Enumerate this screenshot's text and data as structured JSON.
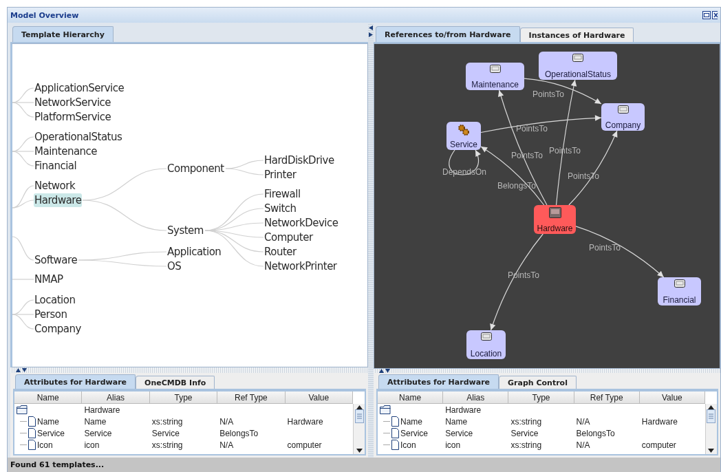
{
  "window": {
    "title": "Model Overview"
  },
  "hierarchy_pane": {
    "tabs": [
      {
        "label": "Template Hierarchy",
        "selected": true
      }
    ],
    "tree": {
      "groups": [
        {
          "children": [
            {
              "label": "ApplicationService",
              "selected": false
            },
            {
              "label": "NetworkService",
              "selected": false
            },
            {
              "label": "PlatformService",
              "selected": false
            }
          ]
        },
        {
          "children": [
            {
              "label": "OperationalStatus",
              "selected": false
            },
            {
              "label": "Maintenance",
              "selected": false
            },
            {
              "label": "Financial",
              "selected": false
            }
          ]
        },
        {
          "children": [
            {
              "label": "Network",
              "selected": false
            },
            {
              "label": "Hardware",
              "selected": true,
              "children": [
                {
                  "label": "Component",
                  "selected": false,
                  "children": [
                    {
                      "label": "HardDiskDrive",
                      "selected": false
                    },
                    {
                      "label": "Printer",
                      "selected": false
                    }
                  ]
                },
                {
                  "label": "System",
                  "selected": false,
                  "children": [
                    {
                      "label": "Firewall",
                      "selected": false
                    },
                    {
                      "label": "Switch",
                      "selected": false
                    },
                    {
                      "label": "NetworkDevice",
                      "selected": false
                    },
                    {
                      "label": "Computer",
                      "selected": false
                    },
                    {
                      "label": "Router",
                      "selected": false
                    },
                    {
                      "label": "NetworkPrinter",
                      "selected": false
                    }
                  ]
                }
              ]
            }
          ]
        },
        {
          "children": [
            {
              "label": "Software",
              "selected": false,
              "children": [
                {
                  "label": "Application",
                  "selected": false
                },
                {
                  "label": "OS",
                  "selected": false
                }
              ]
            }
          ]
        },
        {
          "children": [
            {
              "label": "NMAP",
              "selected": false
            }
          ]
        },
        {
          "children": [
            {
              "label": "Location",
              "selected": false
            },
            {
              "label": "Person",
              "selected": false
            },
            {
              "label": "Company",
              "selected": false
            }
          ]
        }
      ]
    }
  },
  "references_pane": {
    "tabs": [
      {
        "label": "References to/from Hardware",
        "selected": true
      },
      {
        "label": "Instances of Hardware",
        "selected": false
      }
    ],
    "graph": {
      "nodes": [
        {
          "label": "Maintenance",
          "kind": "ci",
          "selected": false
        },
        {
          "label": "OperationalStatus",
          "kind": "ci",
          "selected": false
        },
        {
          "label": "Company",
          "kind": "ci",
          "selected": false
        },
        {
          "label": "Service",
          "kind": "service",
          "selected": false
        },
        {
          "label": "Hardware",
          "kind": "hardware",
          "selected": true
        },
        {
          "label": "Financial",
          "kind": "ci",
          "selected": false
        },
        {
          "label": "Location",
          "kind": "ci",
          "selected": false
        }
      ],
      "edges": [
        {
          "label": "PointsTo"
        },
        {
          "label": "PointsTo"
        },
        {
          "label": "PointsTo"
        },
        {
          "label": "PointsTo"
        },
        {
          "label": "PointsTo"
        },
        {
          "label": "BelongsTo"
        },
        {
          "label": "DependsOn"
        },
        {
          "label": "PointsTo"
        },
        {
          "label": "PointsTo"
        }
      ]
    }
  },
  "attributes_left": {
    "tabs": [
      {
        "label": "Attributes for Hardware",
        "selected": true
      },
      {
        "label": "OneCMDB Info",
        "selected": false
      }
    ],
    "columns": [
      "Name",
      "Alias",
      "Type",
      "Ref Type",
      "Value"
    ],
    "rows": [
      {
        "kind": "group",
        "alias": "Hardware"
      },
      {
        "kind": "attribute",
        "name": "Name",
        "alias": "Name",
        "type": "xs:string",
        "ref_type": "N/A",
        "value": "Hardware"
      },
      {
        "kind": "attribute",
        "name": "Service",
        "alias": "Service",
        "type": "Service",
        "ref_type": "BelongsTo"
      },
      {
        "kind": "attribute",
        "name": "Icon",
        "alias": "icon",
        "type": "xs:string",
        "ref_type": "N/A",
        "value": "computer"
      }
    ]
  },
  "attributes_right": {
    "tabs": [
      {
        "label": "Attributes for Hardware",
        "selected": true
      },
      {
        "label": "Graph Control",
        "selected": false
      }
    ],
    "columns": [
      "Name",
      "Alias",
      "Type",
      "Ref Type",
      "Value"
    ],
    "rows": [
      {
        "kind": "group",
        "alias": "Hardware"
      },
      {
        "kind": "attribute",
        "name": "Name",
        "alias": "Name",
        "type": "xs:string",
        "ref_type": "N/A",
        "value": "Hardware"
      },
      {
        "kind": "attribute",
        "name": "Service",
        "alias": "Service",
        "type": "Service",
        "ref_type": "BelongsTo"
      },
      {
        "kind": "attribute",
        "name": "Icon",
        "alias": "icon",
        "type": "xs:string",
        "ref_type": "N/A",
        "value": "computer"
      }
    ]
  },
  "status_bar": {
    "text": "Found 61 templates..."
  }
}
